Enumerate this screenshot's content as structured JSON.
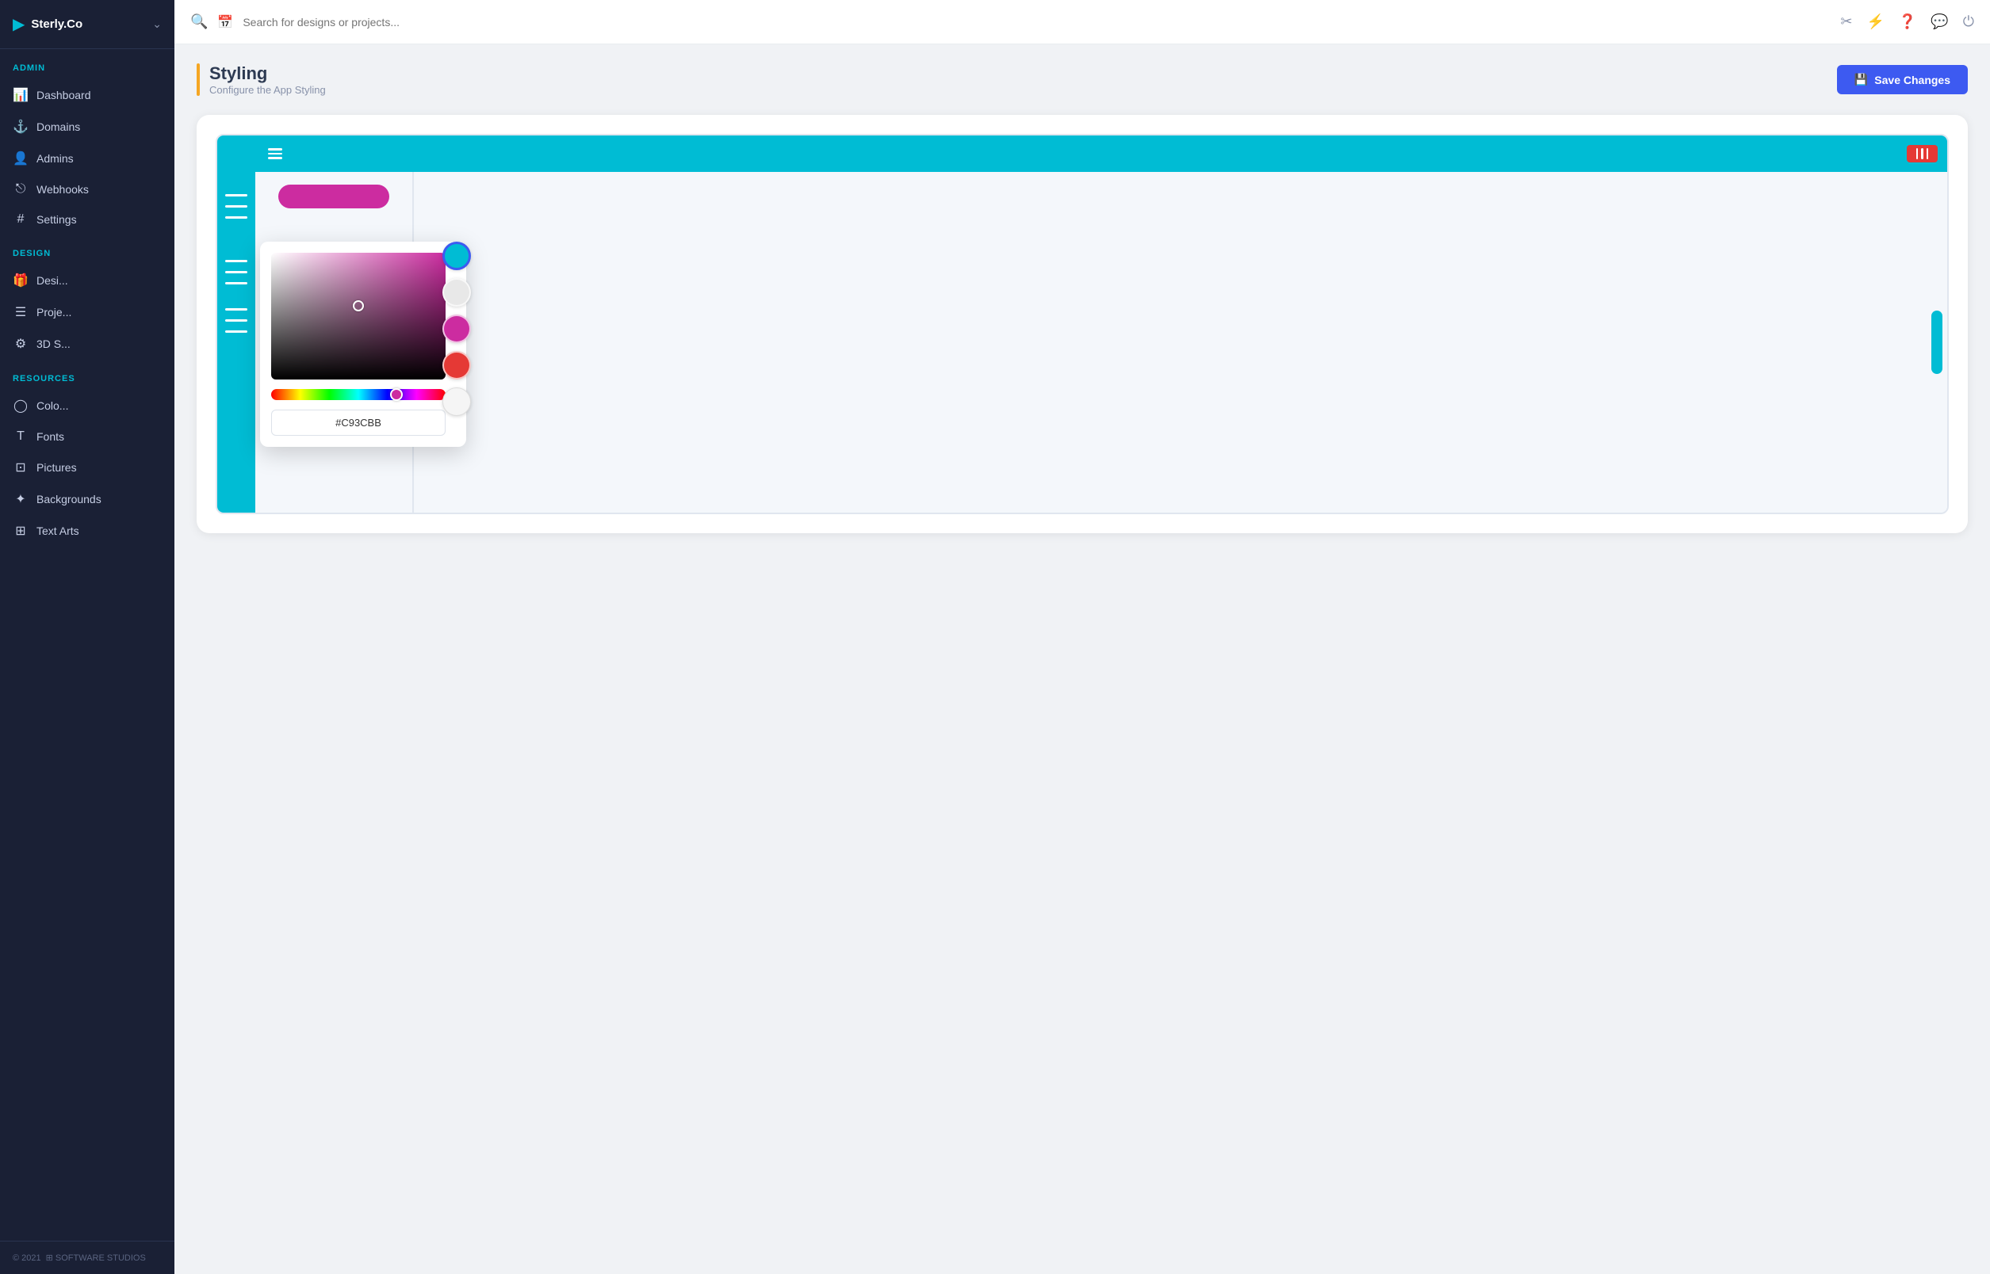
{
  "app": {
    "logo": "Sterly.Co",
    "logo_icon": "▶",
    "chevron": "⌄",
    "footer_year": "© 2021",
    "footer_brand": "⊞ SOFTWARE STUDIOS"
  },
  "sidebar": {
    "admin_label": "ADMIN",
    "design_label": "DESIGN",
    "resources_label": "RESOURCES",
    "admin_items": [
      {
        "id": "dashboard",
        "icon": "📊",
        "label": "Dashboard"
      },
      {
        "id": "domains",
        "icon": "⚓",
        "label": "Domains"
      },
      {
        "id": "admins",
        "icon": "👤",
        "label": "Admins"
      },
      {
        "id": "webhooks",
        "icon": "⎋",
        "label": "Webhooks"
      },
      {
        "id": "settings",
        "icon": "⊞",
        "label": "Settings"
      }
    ],
    "design_items": [
      {
        "id": "designs",
        "icon": "🎁",
        "label": "Desi..."
      },
      {
        "id": "projects",
        "icon": "☰",
        "label": "Proje..."
      },
      {
        "id": "3dscenes",
        "icon": "⚙",
        "label": "3D S..."
      }
    ],
    "resource_items": [
      {
        "id": "colors",
        "icon": "◯",
        "label": "Colo..."
      },
      {
        "id": "fonts",
        "icon": "T",
        "label": "Fonts"
      },
      {
        "id": "pictures",
        "icon": "⊡",
        "label": "Pictures"
      },
      {
        "id": "backgrounds",
        "icon": "✦",
        "label": "Backgrounds"
      },
      {
        "id": "textarts",
        "icon": "⊞",
        "label": "Text Arts"
      }
    ]
  },
  "topbar": {
    "search_placeholder": "Search for designs or projects...",
    "icons": [
      "scissors",
      "activity",
      "help-circle",
      "message-circle",
      "power"
    ]
  },
  "page": {
    "title": "Styling",
    "subtitle": "Configure the App Styling",
    "save_button": "Save Changes"
  },
  "colorpicker": {
    "hex_value": "#C93CBB",
    "swatches": [
      {
        "color": "#00bcd4",
        "label": "cyan"
      },
      {
        "color": "#e8e8e8",
        "label": "light-gray"
      },
      {
        "color": "#cc2ca0",
        "label": "magenta"
      },
      {
        "color": "#e53935",
        "label": "red"
      },
      {
        "color": "#f5f5f5",
        "label": "white-gray"
      }
    ]
  },
  "mockup": {
    "scrollbar_color": "#00bcd4",
    "topbar_color": "#00bcd4",
    "sidebar_color": "#00bcd4",
    "button_color": "#cc2ca0",
    "accent_color": "#e53935"
  }
}
